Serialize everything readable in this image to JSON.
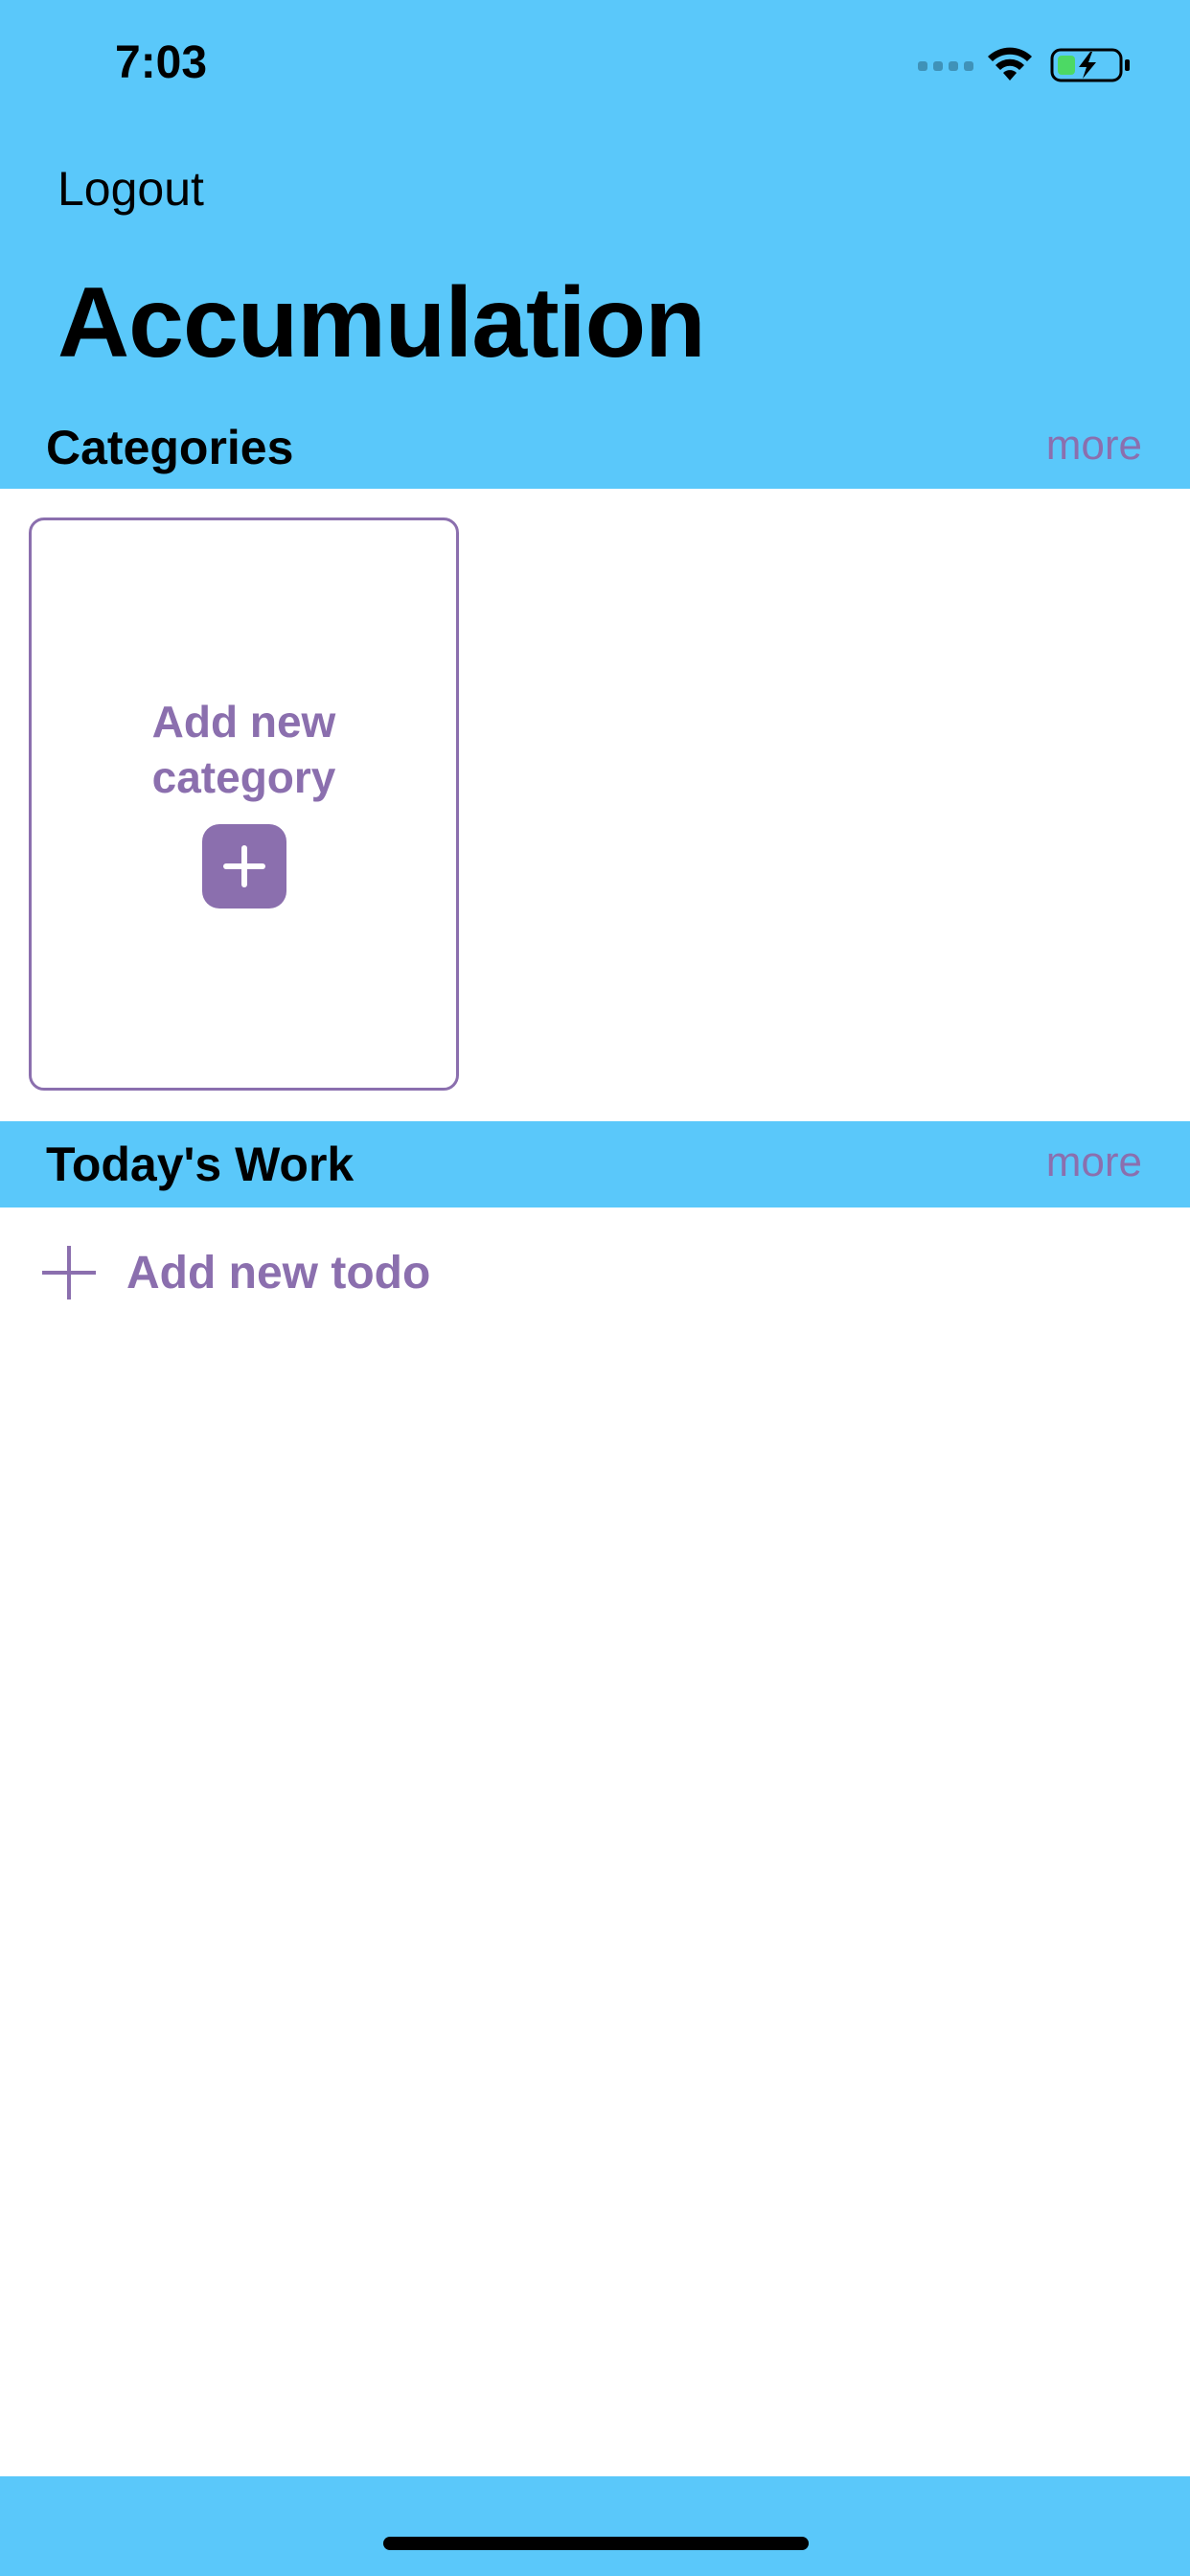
{
  "status_bar": {
    "time": "7:03"
  },
  "header": {
    "logout_label": "Logout",
    "title": "Accumulation"
  },
  "categories": {
    "title": "Categories",
    "more_label": "more",
    "add_card_label": "Add new category"
  },
  "todays_work": {
    "title": "Today's Work",
    "more_label": "more",
    "add_todo_label": "Add new todo"
  },
  "colors": {
    "header_background": "#5ac8fa",
    "accent": "#8b6fae",
    "text": "#000000"
  },
  "icons": [
    "signal-icon",
    "wifi-icon",
    "battery-charging-icon",
    "plus-icon",
    "home-indicator"
  ]
}
